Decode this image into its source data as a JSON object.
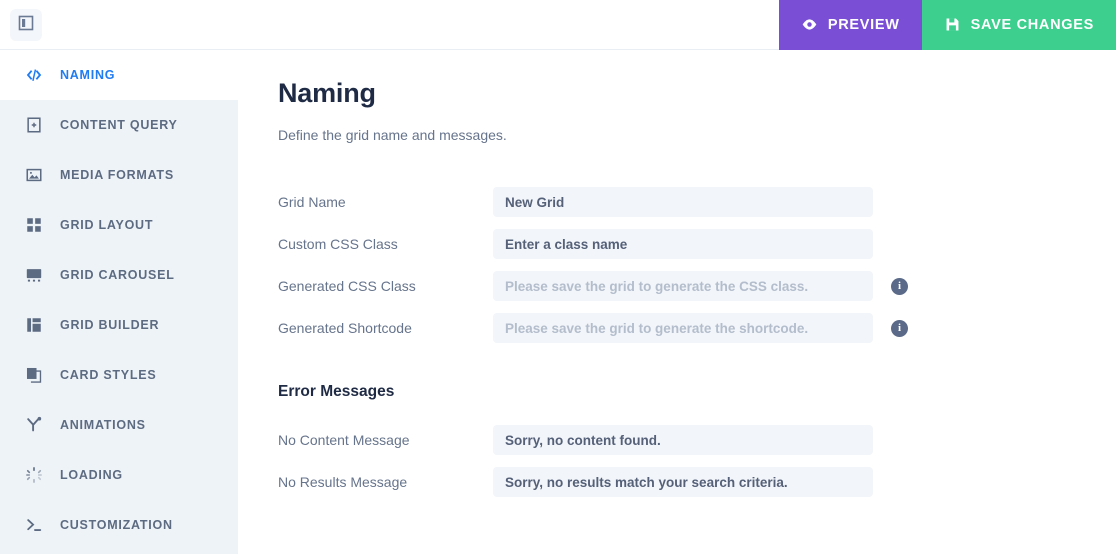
{
  "header": {
    "toggle_icon": "sidebar-toggle-icon",
    "buttons": [
      {
        "label": "Preview",
        "icon": "eye-icon",
        "color": "#7a4fd6"
      },
      {
        "label": "Save Changes",
        "icon": "floppy-disk-icon",
        "color": "#3ccf8e"
      }
    ]
  },
  "sidebar": {
    "active_color": "#1f7cf2",
    "background": "#eef3f8",
    "items": [
      {
        "label": "Naming",
        "icon": "code-icon",
        "active": true
      },
      {
        "label": "Content Query",
        "icon": "document-add-icon",
        "active": false
      },
      {
        "label": "Media Formats",
        "icon": "image-icon",
        "active": false
      },
      {
        "label": "Grid Layout",
        "icon": "grid-squares-icon",
        "active": false
      },
      {
        "label": "Grid Carousel",
        "icon": "monitor-icon",
        "active": false
      },
      {
        "label": "Grid Builder",
        "icon": "layout-columns-icon",
        "active": false
      },
      {
        "label": "Card Styles",
        "icon": "cards-stack-icon",
        "active": false
      },
      {
        "label": "Animations",
        "icon": "magic-wand-icon",
        "active": false
      },
      {
        "label": "Loading",
        "icon": "spinner-icon",
        "active": false
      },
      {
        "label": "Customization",
        "icon": "terminal-prompt-icon",
        "active": false
      }
    ]
  },
  "main": {
    "title": "Naming",
    "description": "Define the grid name and messages.",
    "fields": [
      {
        "label": "Grid Name",
        "value": "New Grid",
        "is_placeholder": false,
        "has_info": false
      },
      {
        "label": "Custom CSS Class",
        "value": "Enter a class name",
        "is_placeholder": false,
        "has_info": false
      },
      {
        "label": "Generated CSS Class",
        "value": "Please save the grid to generate the CSS class.",
        "is_placeholder": true,
        "has_info": true,
        "info_icon": "info-icon"
      },
      {
        "label": "Generated Shortcode",
        "value": "Please save the grid to generate the shortcode.",
        "is_placeholder": true,
        "has_info": true,
        "info_icon": "info-icon"
      }
    ],
    "error_section": {
      "title": "Error Messages",
      "fields": [
        {
          "label": "No Content Message",
          "value": "Sorry, no content found.",
          "is_placeholder": false,
          "has_info": false
        },
        {
          "label": "No Results Message",
          "value": "Sorry, no results match your search criteria.",
          "is_placeholder": false,
          "has_info": false
        }
      ]
    }
  }
}
